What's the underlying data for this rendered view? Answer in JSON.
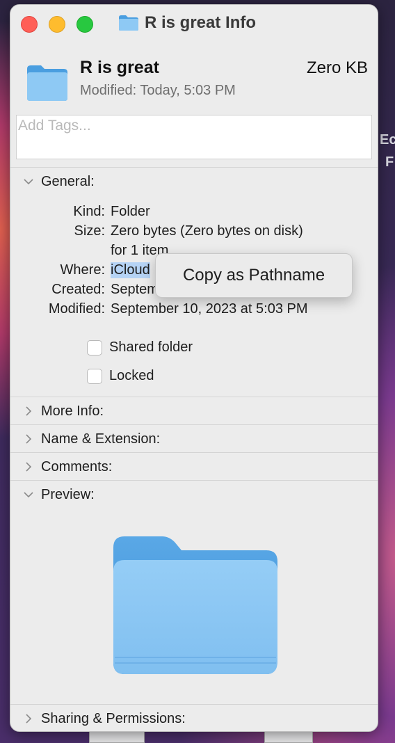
{
  "window": {
    "title": "R is great Info"
  },
  "header": {
    "name": "R is great",
    "size": "Zero KB",
    "modified": "Modified:  Today, 5:03 PM"
  },
  "tags": {
    "placeholder": "Add Tags..."
  },
  "general": {
    "label": "General:",
    "rows": [
      {
        "label": "Kind:",
        "value": "Folder"
      },
      {
        "label": "Size:",
        "value": "Zero bytes (Zero bytes on disk)"
      },
      {
        "label": "",
        "value": "for 1 item"
      },
      {
        "label": "Where:",
        "value": "iCloud"
      },
      {
        "label": "Created:",
        "value": "Septem"
      },
      {
        "label": "Modified:",
        "value": "September 10, 2023 at 5:03 PM"
      }
    ],
    "shared_folder": "Shared folder",
    "locked": "Locked"
  },
  "context_menu": {
    "item": "Copy as Pathname"
  },
  "sections": {
    "more_info": "More Info:",
    "name_extension": "Name & Extension:",
    "comments": "Comments:",
    "preview": "Preview:",
    "sharing": "Sharing & Permissions:"
  },
  "desktop": {
    "text1": "Ec",
    "text2": "F"
  },
  "colors": {
    "folder_light": "#8ec9f4",
    "folder_dark": "#4a9ee0",
    "close": "#ff5f57",
    "minimize": "#febc2e",
    "maximize": "#28c840"
  }
}
